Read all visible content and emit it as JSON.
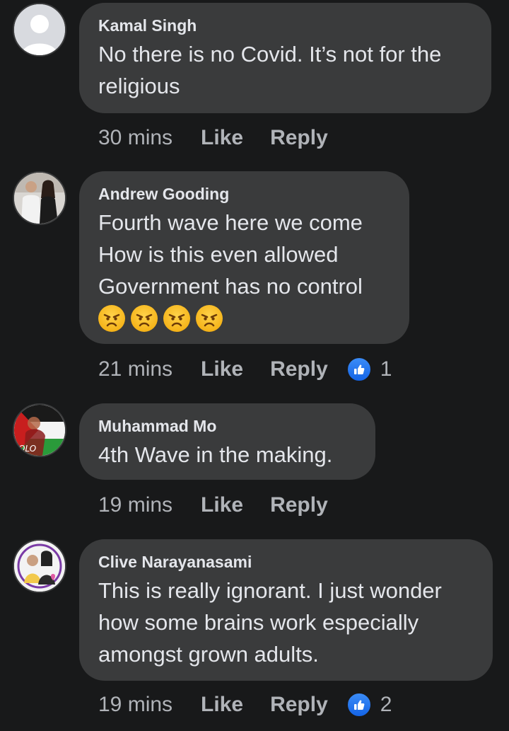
{
  "comments": [
    {
      "author": "Kamal Singh",
      "text": "No there is no Covid. It’s not for the\nreligious",
      "time": "30 mins",
      "like_label": "Like",
      "reply_label": "Reply",
      "avatar": "default-avatar"
    },
    {
      "author": "Andrew Gooding",
      "text": "Fourth wave here we come\nHow is this even allowed\nGovernment has no control",
      "emojis": [
        "angry-face-icon",
        "angry-face-icon",
        "angry-face-icon",
        "angry-face-icon"
      ],
      "time": "21 mins",
      "like_label": "Like",
      "reply_label": "Reply",
      "reaction_count": "1",
      "reaction_icon": "thumbs-up-icon",
      "avatar": "photo-avatar"
    },
    {
      "author": "Muhammad Mo",
      "text": "4th Wave in the making.",
      "time": "19 mins",
      "like_label": "Like",
      "reply_label": "Reply",
      "avatar": "flag-avatar",
      "avatar_text": "OLO"
    },
    {
      "author": "Clive Narayanasami",
      "text": "This is really ignorant. I just wonder\nhow some brains work especially\namongst grown adults.",
      "time": "19 mins",
      "like_label": "Like",
      "reply_label": "Reply",
      "reaction_count": "2",
      "reaction_icon": "thumbs-up-icon",
      "avatar": "photo-frame-avatar"
    }
  ],
  "colors": {
    "background": "#18191a",
    "bubble": "#3a3b3c",
    "text": "#e4e6eb",
    "meta": "#b0b3b8",
    "like_blue": "#1877f2",
    "emoji": "#f5b41a"
  }
}
